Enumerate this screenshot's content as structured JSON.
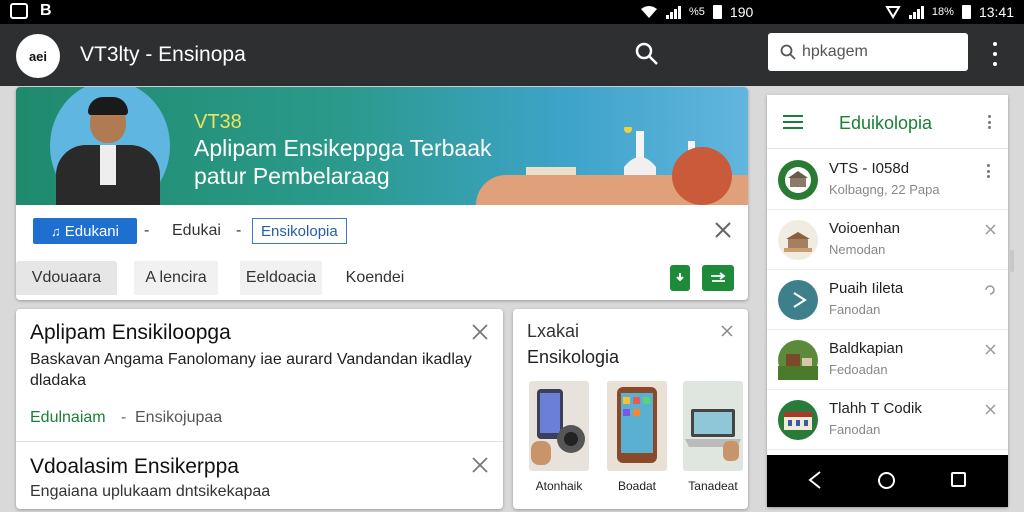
{
  "status_bar": {
    "left_letter": "B",
    "mid_small": "%5",
    "mid_time": "190",
    "right_small": "18%",
    "right_time": "13:41"
  },
  "app_bar": {
    "avatar_text": "aei",
    "title": "VT3lty - Ensinopa",
    "search_placeholder": "hpkagem"
  },
  "banner": {
    "subtitle": "VT38",
    "line1": "Aplipam Ensikeppga Terbaak",
    "line2": "patur Pembelaraag",
    "colors": {
      "accent": "#1e6fd0",
      "green": "#1a7f37",
      "headline": "#f2e35a"
    }
  },
  "chips": {
    "primary": "Edukani",
    "dash": "-",
    "plain": "Edukai",
    "outline": "Ensikolopia"
  },
  "tabs": [
    {
      "label": "Vdouaara"
    },
    {
      "label": "A lencira"
    },
    {
      "label": "Eeldoacia"
    },
    {
      "label": "Koendei"
    }
  ],
  "card_a": {
    "title": "Aplipam Ensikiloopga",
    "description": "Baskavan Angama Fanolomany iae aurard Vandandan ikadlay dladaka",
    "link": "Edulnaiam",
    "separator": "-",
    "meta": "Ensikojupaa",
    "title2": "Vdoalasim Ensikerppa",
    "description2": "Engaiana uplukaam dntsikekapaa"
  },
  "card_b": {
    "line1": "Lxakai",
    "line2": "Ensikologia",
    "products": [
      {
        "label": "Atonhaik"
      },
      {
        "label": "Boadat"
      },
      {
        "label": "Tanadeat"
      }
    ]
  },
  "side_panel": {
    "title": "Eduikolopia",
    "items": [
      {
        "title": "VTS - I058d",
        "subtitle": "Kolbagng, 22 Papa",
        "action": "dots"
      },
      {
        "title": "Voioenhan",
        "subtitle": "Nemodan",
        "action": "close"
      },
      {
        "title": "Puaih Iileta",
        "subtitle": "Fanodan",
        "action": "refresh"
      },
      {
        "title": "Baldkapian",
        "subtitle": "Fedoadan",
        "action": "close"
      },
      {
        "title": "Tlahh T Codik",
        "subtitle": "Fanodan",
        "action": "close"
      }
    ]
  }
}
